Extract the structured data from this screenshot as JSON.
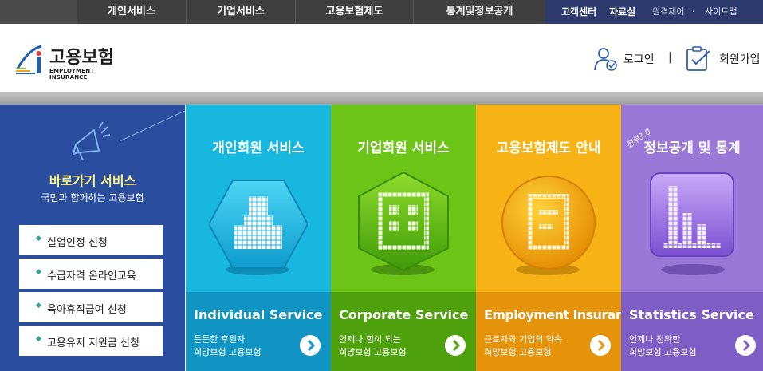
{
  "topnav": {
    "menus": [
      "개인서비스",
      "기업서비스",
      "고용보험제도",
      "통계및정보공개"
    ],
    "util": {
      "customer_center": "고객센터",
      "library": "자료실",
      "remote": "원격제어",
      "dot": "·",
      "sitemap": "사이트맵"
    }
  },
  "header": {
    "logo_ko": "고용보험",
    "logo_en": "EMPLOYMENT INSURANCE",
    "login": "로그인",
    "separator": "|",
    "join": "회원가입"
  },
  "quick": {
    "title": "바로가기 서비스",
    "subtitle": "국민과 함께하는 고용보험",
    "bullet": "◆",
    "items": [
      "실업인정 신청",
      "수급자격 온라인교육",
      "육아휴직급여 신청",
      "고용유지 지원금 신청"
    ]
  },
  "cards": [
    {
      "title": "개인회원 서비스",
      "en": "Individual Service",
      "desc1": "든든한 후원자",
      "desc2": "희망보험 고용보험",
      "icon": "person-icon",
      "color_top": "#17b7e0",
      "color_bottom": "#0f94c4",
      "arrow_color": "#139bd0"
    },
    {
      "title": "기업회원 서비스",
      "en": "Corporate Service",
      "desc1": "언제나 힘이 되는",
      "desc2": "희망보험 고용보험",
      "icon": "building-icon",
      "color_top": "#6bc416",
      "color_bottom": "#4ea10d",
      "arrow_color": "#5aa812"
    },
    {
      "title": "고용보험제도 안내",
      "en": "Employment Insurance",
      "desc1": "근로자와 기업의 약속",
      "desc2": "희망보험 고용보험",
      "icon": "document-icon",
      "color_top": "#f7b316",
      "color_bottom": "#e4930b",
      "arrow_color": "#e99a10"
    },
    {
      "title": "정보공개 및 통계",
      "badge": "정부3.0",
      "en": "Statistics Service",
      "desc1": "언제나 정확한",
      "desc2": "희망보험 고용보험",
      "icon": "bar-chart-icon",
      "color_top": "#9a78d8",
      "color_bottom": "#7e5dc4",
      "arrow_color": "#8763cc"
    }
  ]
}
